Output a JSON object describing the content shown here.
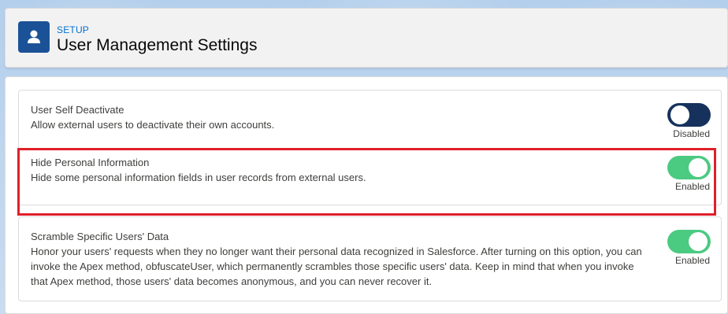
{
  "header": {
    "eyebrow": "SETUP",
    "title": "User Management Settings",
    "icon": "user-icon"
  },
  "settings": [
    {
      "title": "User Self Deactivate",
      "description": "Allow external users to deactivate their own accounts.",
      "state": "Disabled",
      "enabled": false
    },
    {
      "title": "Hide Personal Information",
      "description": "Hide some personal information fields in user records from external users.",
      "state": "Enabled",
      "enabled": true
    },
    {
      "title": "Scramble Specific Users' Data",
      "description_lines": [
        "Honor your users' requests when they no longer want their personal data recognized in Salesforce. After turning on this option, you can",
        "invoke the Apex method, obfuscateUser, which permanently scrambles those specific users' data. Keep in mind that when you invoke",
        "that Apex method, those users' data becomes anonymous, and you can never recover it."
      ],
      "state": "Enabled",
      "enabled": true
    }
  ],
  "colors": {
    "toggle_off": "#16325c",
    "toggle_on": "#4bca81",
    "highlight": "#e0202b",
    "header_icon_bg": "#1b5297",
    "eyebrow": "#0070d2"
  }
}
